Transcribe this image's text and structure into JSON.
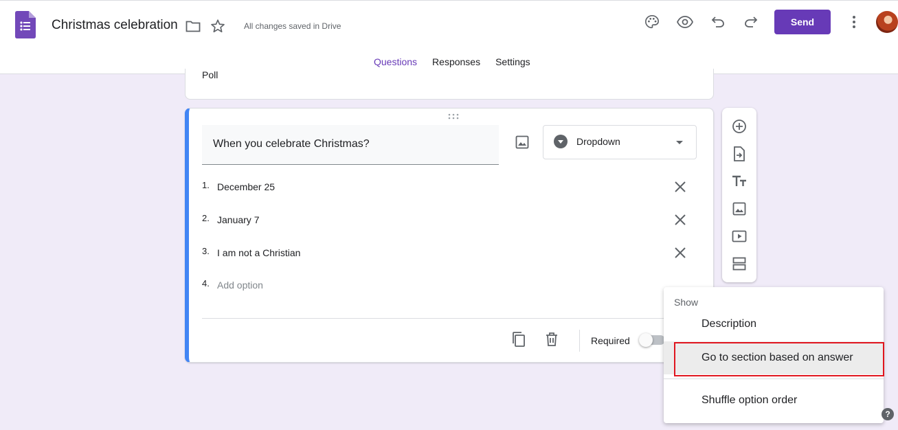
{
  "header": {
    "title": "Christmas celebration",
    "saved_status": "All changes saved in Drive",
    "send_label": "Send"
  },
  "tabs": [
    {
      "label": "Questions",
      "active": true
    },
    {
      "label": "Responses",
      "active": false
    },
    {
      "label": "Settings",
      "active": false
    }
  ],
  "previous_card": {
    "text": "Poll"
  },
  "question": {
    "title": "When you celebrate Christmas?",
    "type": "Dropdown",
    "options": [
      {
        "num": "1.",
        "text": "December 25"
      },
      {
        "num": "2.",
        "text": "January 7"
      },
      {
        "num": "3.",
        "text": "I am not a Christian"
      }
    ],
    "add_option": {
      "num": "4.",
      "text": "Add option"
    },
    "required_label": "Required",
    "required": false
  },
  "menu": {
    "heading": "Show",
    "items": [
      "Description",
      "Go to section based on answer",
      "Shuffle option order"
    ],
    "highlighted": "Go to section based on answer"
  },
  "help_label": "?",
  "colors": {
    "brand": "#673ab7",
    "card_accent": "#4285f4",
    "background": "#f0ebf8",
    "annotation": "#e0141e"
  },
  "icons": [
    "forms-logo-icon",
    "folder-icon",
    "star-icon",
    "palette-icon",
    "eye-icon",
    "undo-icon",
    "redo-icon",
    "more-vert-icon",
    "image-icon",
    "close-icon",
    "copy-icon",
    "trash-icon",
    "add-circle-icon",
    "import-icon",
    "title-icon",
    "video-icon",
    "section-icon"
  ]
}
